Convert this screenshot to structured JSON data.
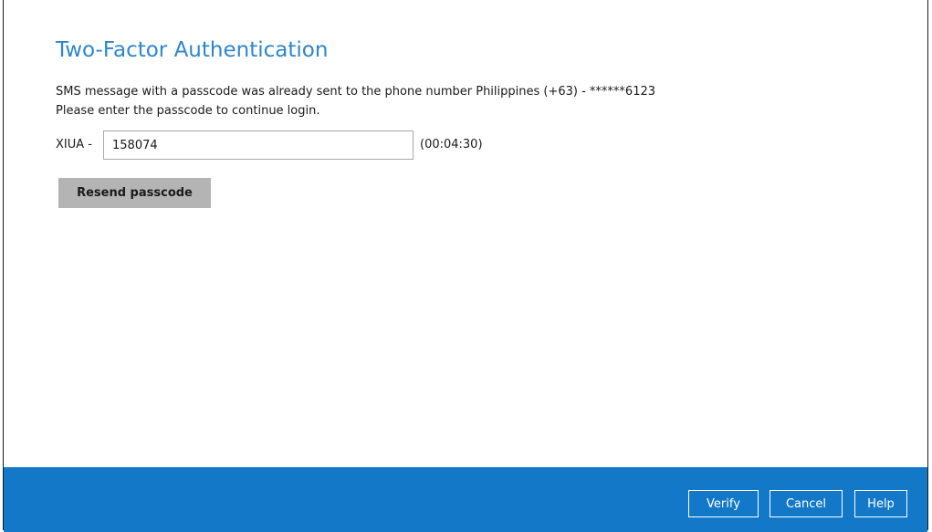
{
  "dialog": {
    "title": "Two-Factor Authentication",
    "message_line1": "SMS message with a passcode was already sent to the phone number Philippines (+63) - ******6123",
    "message_line2": "Please enter the passcode to continue login."
  },
  "passcode": {
    "prefix": "XIUA -",
    "value": "158074",
    "countdown": "(00:04:30)"
  },
  "buttons": {
    "resend_label": "Resend passcode",
    "verify_label": "Verify",
    "cancel_label": "Cancel",
    "help_label": "Help"
  },
  "colors": {
    "title": "#2f86cb",
    "footer_bar": "#1378c7",
    "resend_button": "#b4b4b4"
  }
}
